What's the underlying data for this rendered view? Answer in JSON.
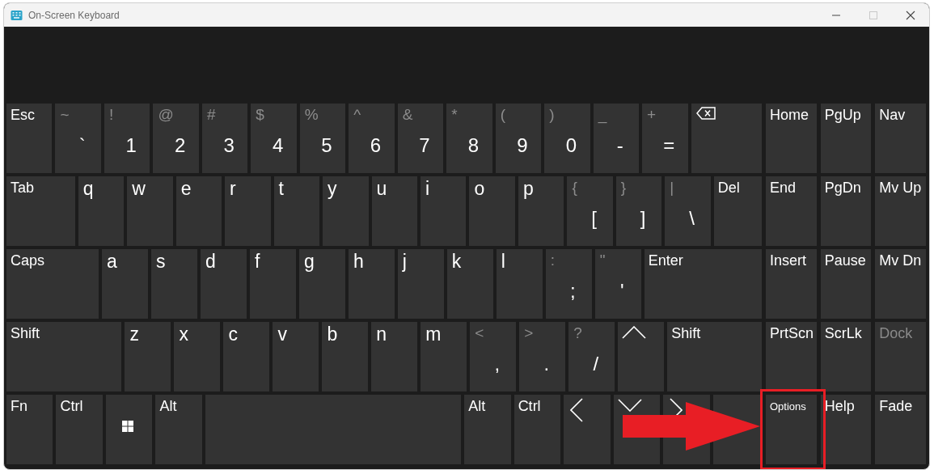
{
  "window": {
    "title": "On-Screen Keyboard"
  },
  "main_rows": [
    [
      {
        "kind": "word",
        "label": "Esc"
      },
      {
        "kind": "dual",
        "shift": "~",
        "main": "`"
      },
      {
        "kind": "dual",
        "shift": "!",
        "main": "1"
      },
      {
        "kind": "dual",
        "shift": "@",
        "main": "2"
      },
      {
        "kind": "dual",
        "shift": "#",
        "main": "3"
      },
      {
        "kind": "dual",
        "shift": "$",
        "main": "4"
      },
      {
        "kind": "dual",
        "shift": "%",
        "main": "5"
      },
      {
        "kind": "dual",
        "shift": "^",
        "main": "6"
      },
      {
        "kind": "dual",
        "shift": "&",
        "main": "7"
      },
      {
        "kind": "dual",
        "shift": "*",
        "main": "8"
      },
      {
        "kind": "dual",
        "shift": "(",
        "main": "9"
      },
      {
        "kind": "dual",
        "shift": ")",
        "main": "0"
      },
      {
        "kind": "dual",
        "shift": "_",
        "main": "-"
      },
      {
        "kind": "dual",
        "shift": "+",
        "main": "="
      },
      {
        "kind": "backspace"
      }
    ],
    [
      {
        "kind": "word",
        "label": "Tab"
      },
      {
        "kind": "char",
        "label": "q"
      },
      {
        "kind": "char",
        "label": "w"
      },
      {
        "kind": "char",
        "label": "e"
      },
      {
        "kind": "char",
        "label": "r"
      },
      {
        "kind": "char",
        "label": "t"
      },
      {
        "kind": "char",
        "label": "y"
      },
      {
        "kind": "char",
        "label": "u"
      },
      {
        "kind": "char",
        "label": "i"
      },
      {
        "kind": "char",
        "label": "o"
      },
      {
        "kind": "char",
        "label": "p"
      },
      {
        "kind": "dual",
        "shift": "{",
        "main": "["
      },
      {
        "kind": "dual",
        "shift": "}",
        "main": "]"
      },
      {
        "kind": "dual",
        "shift": "|",
        "main": "\\"
      },
      {
        "kind": "word",
        "label": "Del"
      }
    ],
    [
      {
        "kind": "word",
        "label": "Caps"
      },
      {
        "kind": "char",
        "label": "a"
      },
      {
        "kind": "char",
        "label": "s"
      },
      {
        "kind": "char",
        "label": "d"
      },
      {
        "kind": "char",
        "label": "f"
      },
      {
        "kind": "char",
        "label": "g"
      },
      {
        "kind": "char",
        "label": "h"
      },
      {
        "kind": "char",
        "label": "j"
      },
      {
        "kind": "char",
        "label": "k"
      },
      {
        "kind": "char",
        "label": "l"
      },
      {
        "kind": "dual",
        "shift": ":",
        "main": ";"
      },
      {
        "kind": "dual",
        "shift": "\"",
        "main": "'"
      },
      {
        "kind": "word",
        "label": "Enter"
      }
    ],
    [
      {
        "kind": "word",
        "label": "Shift"
      },
      {
        "kind": "char",
        "label": "z"
      },
      {
        "kind": "char",
        "label": "x"
      },
      {
        "kind": "char",
        "label": "c"
      },
      {
        "kind": "char",
        "label": "v"
      },
      {
        "kind": "char",
        "label": "b"
      },
      {
        "kind": "char",
        "label": "n"
      },
      {
        "kind": "char",
        "label": "m"
      },
      {
        "kind": "dual",
        "shift": "<",
        "main": ","
      },
      {
        "kind": "dual",
        "shift": ">",
        "main": "."
      },
      {
        "kind": "dual",
        "shift": "?",
        "main": "/"
      },
      {
        "kind": "up"
      },
      {
        "kind": "word",
        "label": "Shift"
      }
    ],
    [
      {
        "kind": "word",
        "label": "Fn"
      },
      {
        "kind": "word",
        "label": "Ctrl"
      },
      {
        "kind": "windows"
      },
      {
        "kind": "word",
        "label": "Alt"
      },
      {
        "kind": "space"
      },
      {
        "kind": "word",
        "label": "Alt"
      },
      {
        "kind": "word",
        "label": "Ctrl"
      },
      {
        "kind": "left"
      },
      {
        "kind": "down"
      },
      {
        "kind": "right"
      },
      {
        "kind": "blank"
      }
    ]
  ],
  "nav_keys": [
    {
      "label": "Home",
      "small": false,
      "disabled": false,
      "highlighted": false
    },
    {
      "label": "PgUp",
      "small": false,
      "disabled": false,
      "highlighted": false
    },
    {
      "label": "Nav",
      "small": false,
      "disabled": false,
      "highlighted": false
    },
    {
      "label": "End",
      "small": false,
      "disabled": false,
      "highlighted": false
    },
    {
      "label": "PgDn",
      "small": false,
      "disabled": false,
      "highlighted": false
    },
    {
      "label": "Mv Up",
      "small": false,
      "disabled": false,
      "highlighted": false
    },
    {
      "label": "Insert",
      "small": false,
      "disabled": false,
      "highlighted": false
    },
    {
      "label": "Pause",
      "small": false,
      "disabled": false,
      "highlighted": false
    },
    {
      "label": "Mv Dn",
      "small": false,
      "disabled": false,
      "highlighted": false
    },
    {
      "label": "PrtScn",
      "small": false,
      "disabled": false,
      "highlighted": false
    },
    {
      "label": "ScrLk",
      "small": false,
      "disabled": false,
      "highlighted": false
    },
    {
      "label": "Dock",
      "small": false,
      "disabled": true,
      "highlighted": false
    },
    {
      "label": "Options",
      "small": true,
      "disabled": false,
      "highlighted": true
    },
    {
      "label": "Help",
      "small": false,
      "disabled": false,
      "highlighted": false
    },
    {
      "label": "Fade",
      "small": false,
      "disabled": false,
      "highlighted": false
    }
  ]
}
